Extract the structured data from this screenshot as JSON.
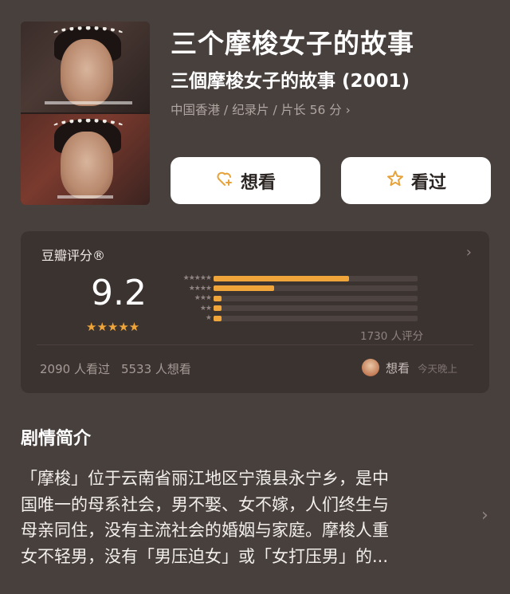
{
  "movie": {
    "title": "三个摩梭女子的故事",
    "subtitle": "三個摩梭女子的故事 (2001)",
    "meta": "中国香港 / 纪录片 / 片长 56 分 ›"
  },
  "actions": {
    "want_label": "想看",
    "seen_label": "看过"
  },
  "rating": {
    "label": "豆瓣评分®",
    "score": "9.2",
    "stars": "★★★★★",
    "distribution": [
      {
        "stars": "★★★★★",
        "fraction": 0.665
      },
      {
        "stars": "★★★★",
        "fraction": 0.295
      },
      {
        "stars": "★★★",
        "fraction": 0.04
      },
      {
        "stars": "★★",
        "fraction": 0.04
      },
      {
        "stars": "★",
        "fraction": 0.04
      }
    ],
    "count_text": "1730 人评分",
    "seen_text": "2090 人看过",
    "want_text": "5533 人想看",
    "friend_action": "想看",
    "friend_time": "今天晚上"
  },
  "synopsis": {
    "title": "剧情简介",
    "lines": [
      "「摩梭」位于云南省丽江地区宁蒗县永宁乡，是中",
      "国唯一的母系社会，男不娶、女不嫁，人们终生与",
      "母亲同住，没有主流社会的婚姻与家庭。摩梭人重",
      "女不轻男，没有「男压迫女」或「女打压男」的..."
    ]
  },
  "colors": {
    "background": "#48403d",
    "card": "#3b3330",
    "accent_star": "#f0a53a",
    "button": "#ffffff"
  },
  "icons": [
    "heart-plus-icon",
    "star-outline-icon",
    "chevron-right-icon"
  ]
}
